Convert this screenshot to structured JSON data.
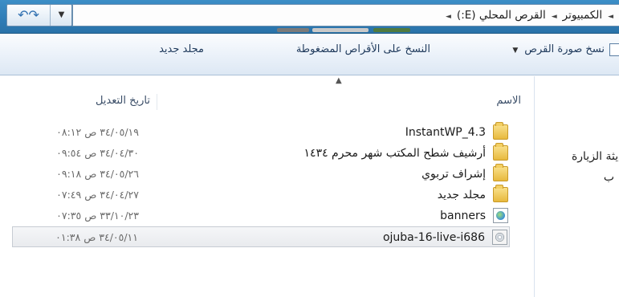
{
  "address_bar": {
    "breadcrumbs": [
      "الكمبيوتر",
      "القرص المحلي (E:)"
    ]
  },
  "toolbar": {
    "burn_image_label": "نسخ صورة القرص",
    "burn_to_disc_label": "النسخ على الأقراص المضغوطة",
    "new_folder_label": "مجلد جديد"
  },
  "nav_pane": {
    "items": [
      "مديثة الزيارة",
      "ب"
    ]
  },
  "columns": {
    "name": "الاسم",
    "date_modified": "تاريخ التعديل"
  },
  "files": [
    {
      "name": "InstantWP_4.3",
      "date": "٣٤/٠٥/١٩ ص ٠٨:١٢",
      "icon": "folder-icon"
    },
    {
      "name": "أرشيف شطح المكتب شهر محرم ١٤٣٤",
      "date": "٣٤/٠٤/٣٠ ص ٠٩:٥٤",
      "icon": "folder-icon"
    },
    {
      "name": "إشراف تربوي",
      "date": "٣٤/٠٥/٢٦ ص ٠٩:١٨",
      "icon": "folder-icon"
    },
    {
      "name": "مجلد جديد",
      "date": "٣٤/٠٤/٢٧ ص ٠٧:٤٩",
      "icon": "folder-icon"
    },
    {
      "name": "banners",
      "date": "٣٣/١٠/٢٣ ص ٠٧:٣٥",
      "icon": "html-file-icon"
    },
    {
      "name": "ojuba-16-live-i686",
      "date": "٣٤/٠٥/١١ ص ٠١:٣٨",
      "icon": "disc-image-icon"
    }
  ],
  "colors": {
    "titlebar": "#2f7eb8",
    "selection": "#e9ebee"
  }
}
